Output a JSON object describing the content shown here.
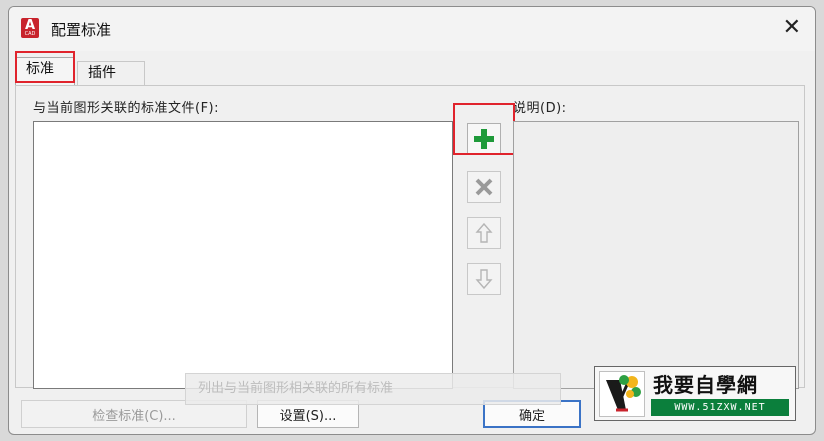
{
  "window": {
    "title": "配置标准",
    "app_icon_letter": "A",
    "app_icon_sub": "CAD"
  },
  "tabs": [
    {
      "label": "标准",
      "active": true
    },
    {
      "label": "插件",
      "active": false
    }
  ],
  "files_panel": {
    "label": "与当前图形关联的标准文件(F):"
  },
  "description_panel": {
    "label": "说明(D):"
  },
  "side_buttons": {
    "add_icon": "plus-icon",
    "remove_icon": "x-icon",
    "up_icon": "arrow-up-icon",
    "down_icon": "arrow-down-icon"
  },
  "tooltip": {
    "text": "列出与当前图形相关联的所有标准"
  },
  "buttons": {
    "check": "检查标准(C)...",
    "settings": "设置(S)...",
    "ok": "确定"
  },
  "watermark": {
    "title": "我要自學網",
    "url": "WWW.51ZXW.NET"
  },
  "colors": {
    "highlight": "#e0232c",
    "add_green": "#1f9a3a",
    "brand_red": "#c8232c",
    "watermark_green": "#0b7f3c"
  }
}
